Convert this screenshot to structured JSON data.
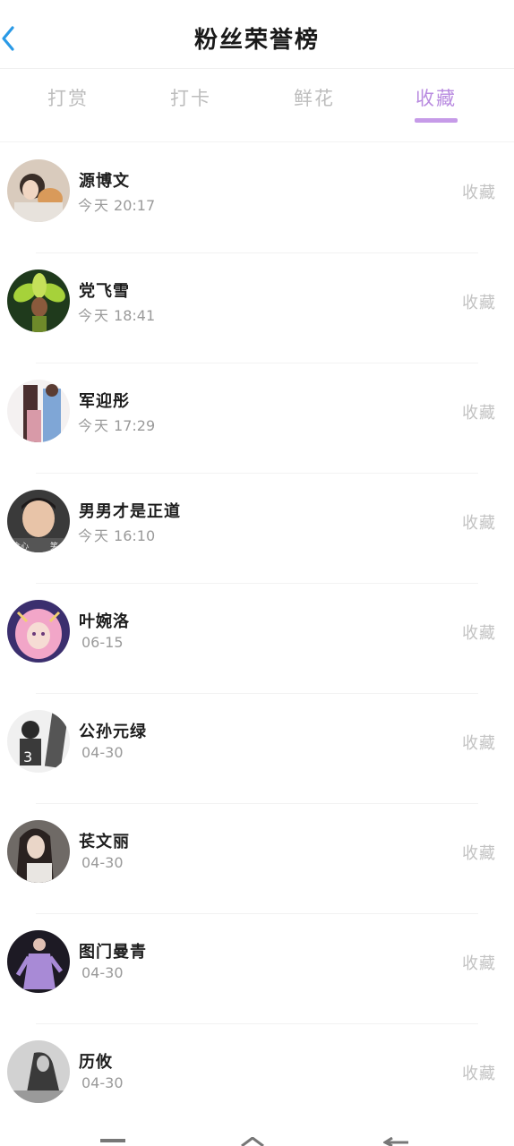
{
  "header": {
    "title": "粉丝荣誉榜",
    "back_icon": "chevron-left-icon",
    "back_color": "#2a9ae6"
  },
  "tabs": [
    {
      "label": "打赏",
      "active": false
    },
    {
      "label": "打卡",
      "active": false
    },
    {
      "label": "鲜花",
      "active": false
    },
    {
      "label": "收藏",
      "active": true
    }
  ],
  "accent_color": "#b98be0",
  "fans": [
    {
      "name": "源博文",
      "day": "今天",
      "time": "20:17",
      "action": "收藏"
    },
    {
      "name": "党飞雪",
      "day": "今天",
      "time": "18:41",
      "action": "收藏"
    },
    {
      "name": "军迎彤",
      "day": "今天",
      "time": "17:29",
      "action": "收藏"
    },
    {
      "name": "男男才是正道",
      "day": "今天",
      "time": "16:10",
      "action": "收藏"
    },
    {
      "name": "叶婉洛",
      "day": "",
      "time": "06-15",
      "action": "收藏"
    },
    {
      "name": "公孙元绿",
      "day": "",
      "time": "04-30",
      "action": "收藏"
    },
    {
      "name": "苌文丽",
      "day": "",
      "time": "04-30",
      "action": "收藏"
    },
    {
      "name": "图门曼青",
      "day": "",
      "time": "04-30",
      "action": "收藏"
    },
    {
      "name": "历攸",
      "day": "",
      "time": "04-30",
      "action": "收藏"
    }
  ],
  "nav_icons": [
    "menu-icon",
    "home-icon",
    "back-icon"
  ]
}
